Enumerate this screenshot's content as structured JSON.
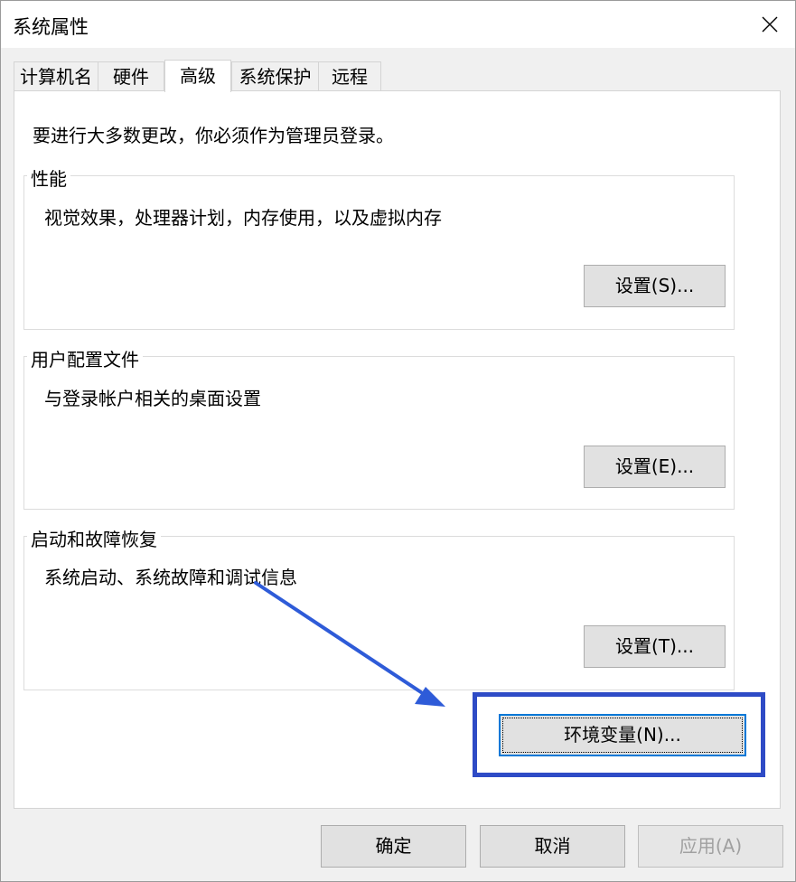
{
  "window": {
    "title": "系统属性",
    "close_icon": "close-icon"
  },
  "tabs": [
    {
      "label": "计算机名"
    },
    {
      "label": "硬件"
    },
    {
      "label": "高级",
      "active": true
    },
    {
      "label": "系统保护"
    },
    {
      "label": "远程"
    }
  ],
  "notice": "要进行大多数更改，你必须作为管理员登录。",
  "groups": {
    "performance": {
      "title": "性能",
      "description": "视觉效果，处理器计划，内存使用，以及虚拟内存",
      "button": "设置(S)..."
    },
    "user_profile": {
      "title": "用户配置文件",
      "description": "与登录帐户相关的桌面设置",
      "button": "设置(E)..."
    },
    "startup": {
      "title": "启动和故障恢复",
      "description": "系统启动、系统故障和调试信息",
      "button": "设置(T)..."
    }
  },
  "env_button": "环境变量(N)...",
  "footer": {
    "ok": "确定",
    "cancel": "取消",
    "apply": "应用(A)"
  },
  "colors": {
    "highlight": "#2e4bc6",
    "arrow": "#2e5bd8",
    "focus": "#0078d7"
  }
}
